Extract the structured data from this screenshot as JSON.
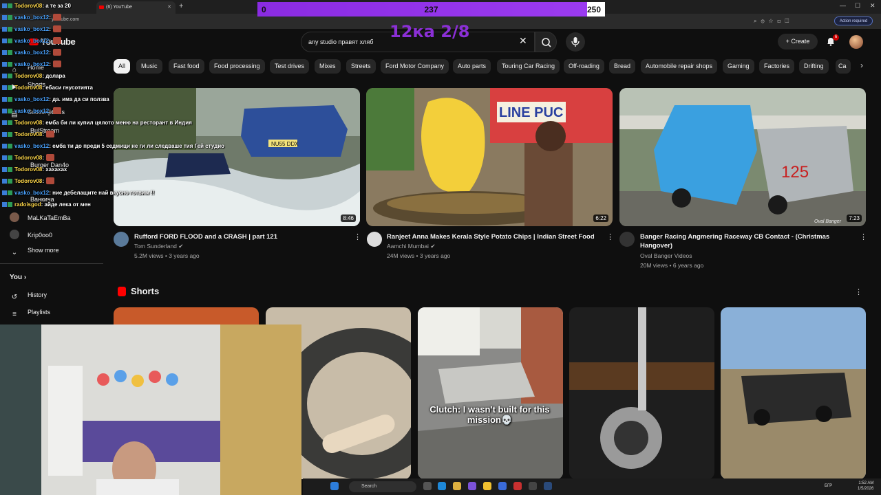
{
  "browser": {
    "tab_title": "(6) YouTube",
    "url": "youtube.com",
    "action_required": "Action required"
  },
  "goal_overlay": {
    "min": "0",
    "current": "237",
    "max": "250",
    "progress_fraction": 0.948,
    "title": "12ка 2/8"
  },
  "header": {
    "logo": "YouTube",
    "search_value": "any studio правят хляб",
    "create_label": "Create",
    "notification_count": "6"
  },
  "chips": [
    "All",
    "Music",
    "Fast food",
    "Food processing",
    "Test drives",
    "Mixes",
    "Streets",
    "Ford Motor Company",
    "Auto parts",
    "Touring Car Racing",
    "Off-roading",
    "Bread",
    "Automobile repair shops",
    "Gaming",
    "Factories",
    "Drifting",
    "Ca"
  ],
  "sidebar": {
    "home": "Home",
    "shorts": "Shorts",
    "subscriptions": "Subscriptions",
    "subs": [
      "BulStream",
      "Burger Dan4o",
      "Ванкича",
      "MaLKaTaEmBa",
      "Krip0oo0"
    ],
    "show_more": "Show more",
    "you": "You",
    "history": "History",
    "playlists": "Playlists"
  },
  "chat": [
    {
      "nick": "Todorov08",
      "color": "y",
      "msg": ": а те за 20"
    },
    {
      "nick": "vasko_box12",
      "color": "b",
      "msg": ":"
    },
    {
      "nick": "vasko_box12",
      "color": "b",
      "msg": ":"
    },
    {
      "nick": "vasko_box12",
      "color": "b",
      "msg": ":"
    },
    {
      "nick": "vasko_box12",
      "color": "b",
      "msg": ":"
    },
    {
      "nick": "vasko_box12",
      "color": "b",
      "msg": ":"
    },
    {
      "nick": "Todorov08",
      "color": "y",
      "msg": ": долара"
    },
    {
      "nick": "Todorov08",
      "color": "y",
      "msg": ": ебаси гнусотията"
    },
    {
      "nick": "vasko_box12",
      "color": "b",
      "msg": ": да. има да си ползва"
    },
    {
      "nick": "vasko_box12",
      "color": "b",
      "msg": ":"
    },
    {
      "nick": "Todorov08",
      "color": "y",
      "msg": ": емба би ли купил цялото меню на ресторант в Индия"
    },
    {
      "nick": "Todorov08",
      "color": "y",
      "msg": ":"
    },
    {
      "nick": "vasko_box12",
      "color": "b",
      "msg": ": емба ти до преди 5 седмици не ги ли следваше тия Гей студио"
    },
    {
      "nick": "Todorov08",
      "color": "y",
      "msg": ":"
    },
    {
      "nick": "Todorov08",
      "color": "y",
      "msg": ": хахахах"
    },
    {
      "nick": "Todorov08",
      "color": "y",
      "msg": ":"
    },
    {
      "nick": "vasko_box12",
      "color": "b",
      "msg": ": ние дебелащите най вкусно готвим !!"
    },
    {
      "nick": "radoisgod",
      "color": "y",
      "msg": ": айде лека от мен"
    }
  ],
  "videos": [
    {
      "title": "Rufford FORD FLOOD and a CRASH | part 121",
      "channel": "Tom Sunderland",
      "views": "5.2M views",
      "age": "3 years ago",
      "duration": "8:46",
      "plate": "NU55 DDX"
    },
    {
      "title": "Ranjeet Anna Makes Kerala Style Potato Chips | Indian Street Food",
      "channel": "Aamchi Mumbai",
      "views": "24M views",
      "age": "3 years ago",
      "duration": "6:22",
      "sign": "LINE PUC"
    },
    {
      "title": "Banger Racing Angmering Raceway CB Contact - (Christmas Hangover)",
      "channel": "Oval Banger Videos",
      "views": "20M views",
      "age": "6 years ago",
      "duration": "7:23",
      "car_number": "125",
      "watermark": "Oval Banger"
    }
  ],
  "shorts": {
    "title": "Shorts",
    "clutch_caption": "Clutch: I wasn't built for this mission💀"
  },
  "taskbar": {
    "search": "Search",
    "lang": "БГР",
    "time": "1:52 AM",
    "date": "1/5/2026"
  },
  "colors": {
    "accent_purple": "#8b2fd6",
    "yt_red": "#ff0000",
    "bg": "#0f0f0f"
  }
}
